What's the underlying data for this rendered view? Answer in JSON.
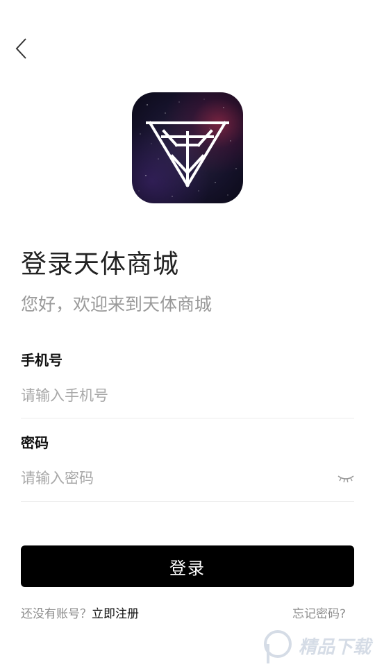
{
  "header": {
    "back_icon": "chevron-left-icon"
  },
  "logo": {
    "icon": "triangle-emblem-icon"
  },
  "title": "登录天体商城",
  "subtitle": "您好，欢迎来到天体商城",
  "phone": {
    "label": "手机号",
    "placeholder": "请输入手机号",
    "value": ""
  },
  "password": {
    "label": "密码",
    "placeholder": "请输入密码",
    "value": "",
    "toggle_icon": "eye-closed-icon"
  },
  "login_button": "登录",
  "footer": {
    "no_account": "还没有账号？",
    "register": "立即注册",
    "forgot": "忘记密码?"
  },
  "watermark": {
    "text": "精品下载"
  },
  "colors": {
    "primary_button": "#000000",
    "placeholder": "#a8a8a8",
    "secondary_text": "#9a9a9a",
    "divider": "#ececec"
  }
}
